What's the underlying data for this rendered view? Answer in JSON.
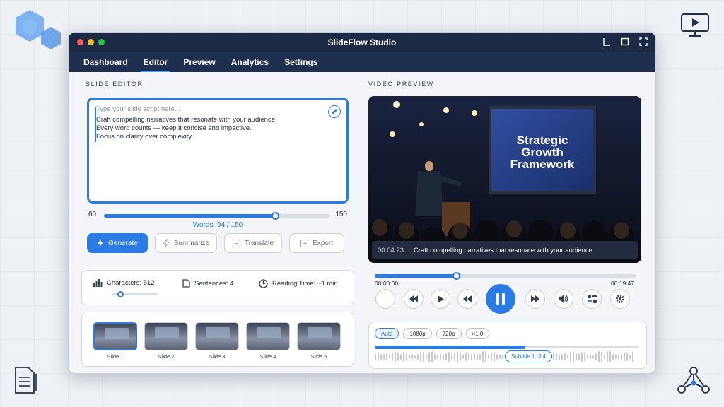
{
  "window": {
    "title": "SlideFlow Studio"
  },
  "menu": [
    {
      "label": "Dashboard",
      "active": false
    },
    {
      "label": "Editor",
      "active": true
    },
    {
      "label": "Preview",
      "active": false
    },
    {
      "label": "Analytics",
      "active": false
    },
    {
      "label": "Settings",
      "active": false
    }
  ],
  "editor": {
    "section_title": "SLIDE EDITOR",
    "placeholder": "Type your slide script here...",
    "lines": [
      "Craft compelling narratives that resonate with your audience.",
      "Every word counts — keep it concise and impactive.",
      "Focus on clarity over complexity."
    ],
    "slider": {
      "min": "60",
      "max": "150",
      "value": 128
    },
    "words_label": "Words: 94 / 150",
    "buttons": {
      "generate": "Generate",
      "summarize": "Summarize",
      "translate": "Translate",
      "export": "Export"
    }
  },
  "stats": {
    "characters": "Characters: 512",
    "sentences": "Sentences: 4",
    "reading_time": "Reading Time: ~1 min"
  },
  "slides": [
    {
      "label": "Slide 1",
      "selected": true
    },
    {
      "label": "Slide 2",
      "selected": false
    },
    {
      "label": "Slide 3",
      "selected": false
    },
    {
      "label": "Slide 4",
      "selected": false
    },
    {
      "label": "Slide 5",
      "selected": false
    }
  ],
  "preview": {
    "section_title": "VIDEO PREVIEW",
    "screen_text": [
      "Strategic",
      "Growth",
      "Framework"
    ],
    "caption_time": "00:04:23",
    "caption_text": "Craft compelling narratives that resonate with your audience.",
    "time_start": "00:00:00",
    "time_end": "00:19:47",
    "progress_fraction": 0.31
  },
  "quality": {
    "chips": [
      {
        "label": "Auto",
        "selected": true
      },
      {
        "label": "1080p",
        "selected": false
      },
      {
        "label": "720p",
        "selected": false
      },
      {
        "label": "×1.0",
        "selected": false
      }
    ],
    "subtitle_badge": "Subtitle 1 of 4",
    "subtitle_progress": 0.57
  },
  "colors": {
    "accent": "#2a7be4",
    "titlebar": "#1c2a45",
    "menubar": "#1e2f50"
  }
}
